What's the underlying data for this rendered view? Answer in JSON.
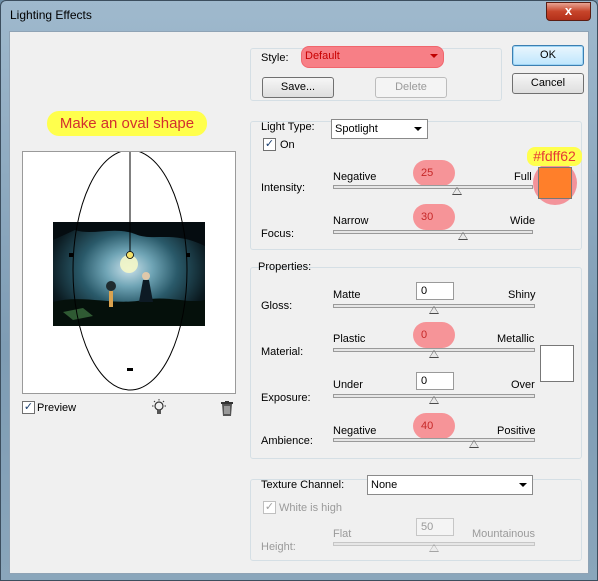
{
  "window": {
    "title": "Lighting Effects",
    "close_label": "x"
  },
  "annotations": {
    "oval_note": "Make an oval shape",
    "color_hex": "#fdff62"
  },
  "style": {
    "label": "Style:",
    "value": "Default",
    "save_label": "Save...",
    "delete_label": "Delete"
  },
  "buttons": {
    "ok": "OK",
    "cancel": "Cancel"
  },
  "light_type": {
    "label": "Light Type:",
    "value": "Spotlight",
    "on_label": "On",
    "intensity": {
      "label": "Intensity:",
      "left": "Negative",
      "right": "Full",
      "value": "25",
      "fraction": 0.62
    },
    "focus": {
      "label": "Focus:",
      "left": "Narrow",
      "right": "Wide",
      "value": "30",
      "fraction": 0.65
    },
    "light_color": "#ff7f2a"
  },
  "properties": {
    "label": "Properties:",
    "gloss": {
      "label": "Gloss:",
      "left": "Matte",
      "right": "Shiny",
      "value": "0",
      "fraction": 0.5
    },
    "material": {
      "label": "Material:",
      "left": "Plastic",
      "right": "Metallic",
      "value": "0",
      "fraction": 0.5
    },
    "exposure": {
      "label": "Exposure:",
      "left": "Under",
      "right": "Over",
      "value": "0",
      "fraction": 0.5
    },
    "ambience": {
      "label": "Ambience:",
      "left": "Negative",
      "right": "Positive",
      "value": "40",
      "fraction": 0.7
    },
    "ambient_color": "#ffffff"
  },
  "texture": {
    "label": "Texture Channel:",
    "value": "None",
    "white_is_high_label": "White is high",
    "height": {
      "label": "Height:",
      "left": "Flat",
      "right": "Mountainous",
      "value": "50",
      "fraction": 0.5
    }
  },
  "preview": {
    "label": "Preview"
  }
}
